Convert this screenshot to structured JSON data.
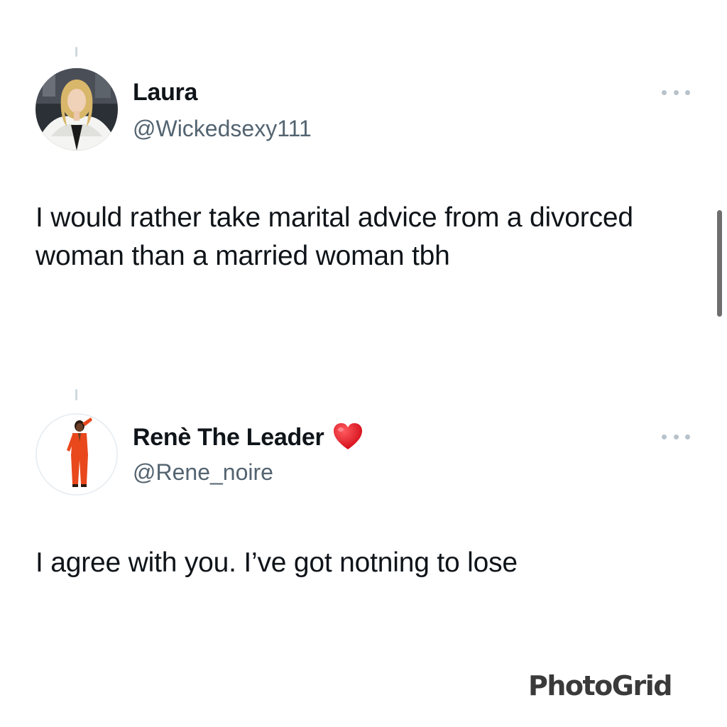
{
  "tweets": [
    {
      "display_name": "Laura",
      "handle": "@Wickedsexy111",
      "text": "I would rather take marital advice from a divorced woman than a married woman tbh",
      "more_icon": "more-horizontal-icon"
    },
    {
      "display_name": "Renè The Leader",
      "handle": "@Rene_noire",
      "text": "I agree with you. I’ve got notning to lose",
      "emoji": "red-heart-icon",
      "more_icon": "more-horizontal-icon"
    }
  ],
  "watermark": "PhotoGrid",
  "colors": {
    "text": "#0f1419",
    "secondary": "#536471",
    "heart": "#e0141e",
    "suit": "#e8481c"
  }
}
